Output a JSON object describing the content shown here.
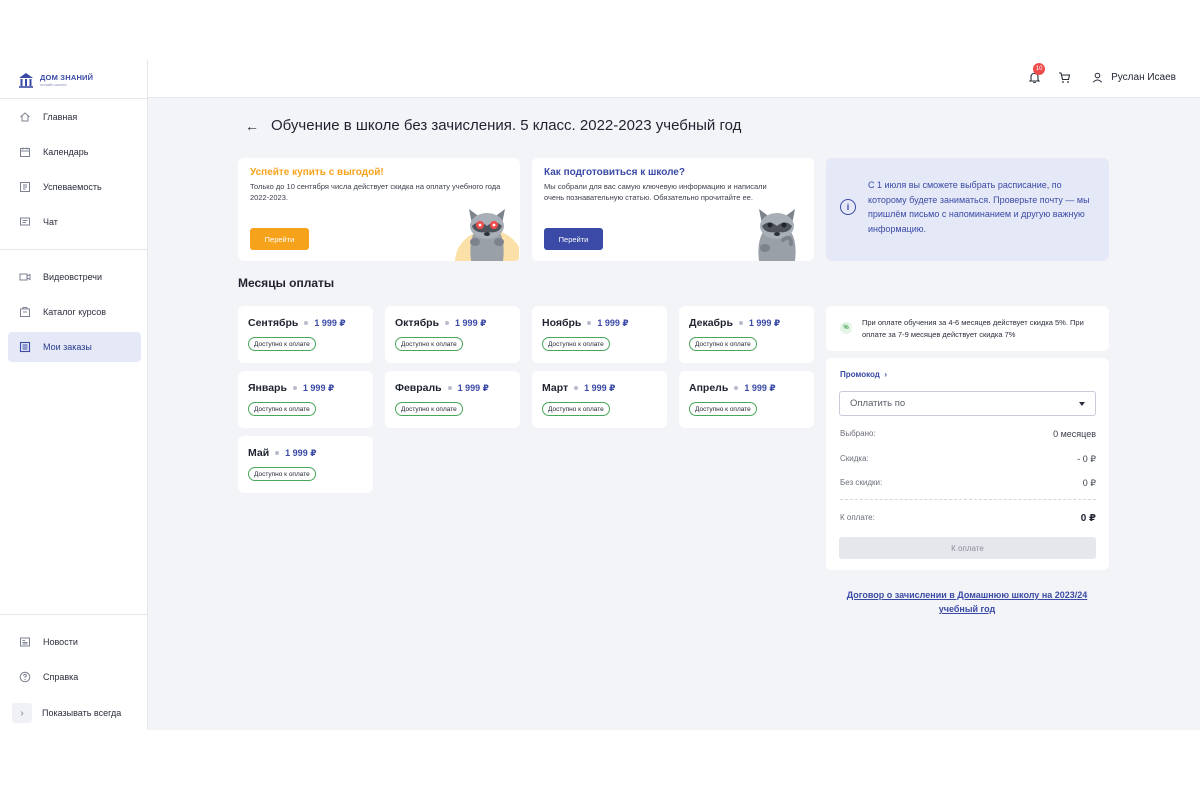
{
  "brand": {
    "name": "ДОМ ЗНАНИЙ",
    "tagline": "онлайн-школа"
  },
  "sidebar": {
    "items": [
      {
        "label": "Главная",
        "icon": "home-icon"
      },
      {
        "label": "Календарь",
        "icon": "calendar-icon"
      },
      {
        "label": "Успеваемость",
        "icon": "grades-icon"
      },
      {
        "label": "Чат",
        "icon": "chat-icon"
      },
      {
        "label": "Видеовстречи",
        "icon": "video-icon"
      },
      {
        "label": "Каталог курсов",
        "icon": "catalog-icon"
      },
      {
        "label": "Мои заказы",
        "icon": "orders-icon",
        "active": true
      }
    ],
    "bottom": [
      {
        "label": "Новости",
        "icon": "news-icon"
      },
      {
        "label": "Справка",
        "icon": "help-icon"
      }
    ],
    "collapse_label": "Показывать всегда"
  },
  "header": {
    "notifications_count": "10",
    "user_name": "Руслан Исаев"
  },
  "page": {
    "title": "Обучение в школе без зачисления. 5 класс. 2022-2023 учебный год"
  },
  "promos": [
    {
      "title": "Успейте купить с выгодой!",
      "text": "Только до 10 сентября числа действует скидка на оплату учебного года 2022-2023.",
      "button": "Перейти",
      "accent": "#f7a21b"
    },
    {
      "title": "Как подготовиться к школе?",
      "text": "Мы собрали для вас самую ключевую информацию и написали очень познавательную статью. Обязательно прочитайте ее.",
      "button": "Перейти",
      "accent": "#3a4aa6"
    }
  ],
  "info": {
    "text": "С 1 июля вы сможете выбрать расписание, по которому будете заниматься. Проверьте почту — мы пришлём письмо с напоминанием и другую важную информацию."
  },
  "months_section": {
    "title": "Месяцы оплаты"
  },
  "months": [
    {
      "name": "Сентябрь",
      "price": "1 999 ₽",
      "status": "Доступно к оплате"
    },
    {
      "name": "Октябрь",
      "price": "1 999 ₽",
      "status": "Доступно к оплате"
    },
    {
      "name": "Ноябрь",
      "price": "1 999 ₽",
      "status": "Доступно к оплате"
    },
    {
      "name": "Декабрь",
      "price": "1 999 ₽",
      "status": "Доступно к оплате"
    },
    {
      "name": "Январь",
      "price": "1 999 ₽",
      "status": "Доступно к оплате"
    },
    {
      "name": "Февраль",
      "price": "1 999 ₽",
      "status": "Доступно к оплате"
    },
    {
      "name": "Март",
      "price": "1 999 ₽",
      "status": "Доступно к оплате"
    },
    {
      "name": "Апрель",
      "price": "1 999 ₽",
      "status": "Доступно к оплате"
    },
    {
      "name": "Май",
      "price": "1 999 ₽",
      "status": "Доступно к оплате"
    }
  ],
  "discount": {
    "icon_text": "%",
    "text": "При оплате обучения за 4-6 месяцев действует скидка 5%. При оплате за 7-9 месяцев действует скидка 7%"
  },
  "payment": {
    "promo_link": "Промокод",
    "select_placeholder": "Оплатить по",
    "rows": [
      {
        "label": "Выбрано:",
        "value": "0 месяцев"
      },
      {
        "label": "Скидка:",
        "value": "- 0 ₽"
      },
      {
        "label": "Без скидки:",
        "value": "0 ₽"
      }
    ],
    "total_label": "К оплате:",
    "total_value": "0 ₽",
    "button": "К оплате"
  },
  "contract_link": "Договор о зачислении в Домашнюю школу на 2023/24 учебный год"
}
